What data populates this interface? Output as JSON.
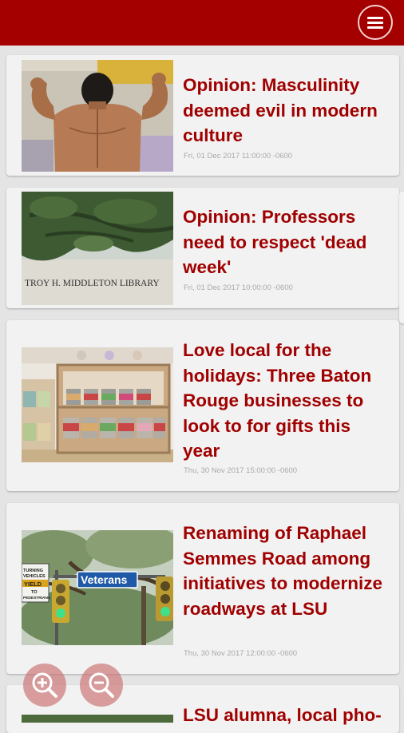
{
  "header": {
    "menu_icon": "hamburger-menu-icon",
    "color": "#a50000"
  },
  "articles": [
    {
      "title": "Opinion: Masculinity deemed evil in modern culture",
      "date": "Fri, 01 Dec 2017 11:00:00 -0600",
      "image": "bodybuilder-photo"
    },
    {
      "title": "Opinion: Professors need to respect 'dead week'",
      "date": "Fri, 01 Dec 2017 10:00:00 -0600",
      "image": "library-oak-tree-photo",
      "image_sign": "TROY H. MIDDLETON LIBRARY"
    },
    {
      "title": "Love local for the holidays: Three Baton Rouge businesses to look to for gifts this year",
      "date": "Thu, 30 Nov 2017 15:00:00 -0600",
      "image": "candle-shelf-photo"
    },
    {
      "title": "Renaming of Raphael Semmes Road among initiatives to modernize roadways at LSU",
      "date": "Thu, 30 Nov 2017 12:00:00 -0600",
      "image": "traffic-light-street-sign-photo",
      "image_sign": "Veterans",
      "image_signs_left": [
        "TURNING",
        "VEHICLES",
        "YIELD",
        "TO",
        "PEDESTRIANS"
      ]
    },
    {
      "title": "LSU alumna, local pho-",
      "date": "",
      "image": "partial-photo"
    }
  ],
  "zoom": {
    "zoom_in_icon": "zoom-in-icon",
    "zoom_out_icon": "zoom-out-icon"
  },
  "colors": {
    "title": "#a00000",
    "date": "#a9a9a9",
    "card": "#f2f2f2",
    "background": "#e4e4e4"
  }
}
